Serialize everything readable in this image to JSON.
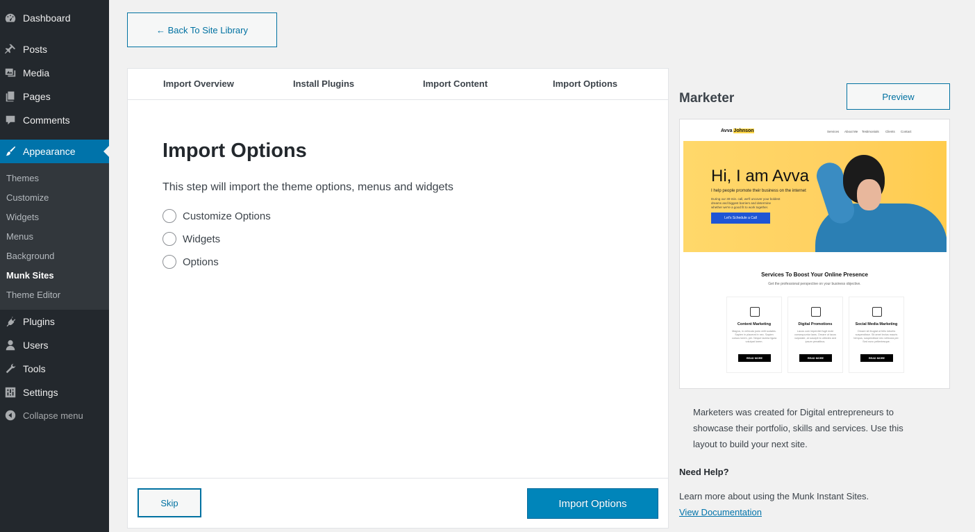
{
  "sidebar": {
    "menu": [
      {
        "label": "Dashboard",
        "icon": "dashboard-icon"
      },
      {
        "label": "Posts",
        "icon": "pin-icon"
      },
      {
        "label": "Media",
        "icon": "media-icon"
      },
      {
        "label": "Pages",
        "icon": "pages-icon"
      },
      {
        "label": "Comments",
        "icon": "comment-icon"
      },
      {
        "label": "Appearance",
        "icon": "brush-icon"
      },
      {
        "label": "Plugins",
        "icon": "plug-icon"
      },
      {
        "label": "Users",
        "icon": "user-icon"
      },
      {
        "label": "Tools",
        "icon": "wrench-icon"
      },
      {
        "label": "Settings",
        "icon": "settings-icon"
      }
    ],
    "submenu": [
      "Themes",
      "Customize",
      "Widgets",
      "Menus",
      "Background",
      "Munk Sites",
      "Theme Editor"
    ],
    "collapse_label": "Collapse menu",
    "active_color": "#0073aa"
  },
  "back_button": "← Back To Site Library",
  "steps": [
    "Import Overview",
    "Install Plugins",
    "Import Content",
    "Import Options"
  ],
  "content": {
    "title": "Import Options",
    "description": "This step will import the theme options, menus and widgets",
    "options": [
      "Customize Options",
      "Widgets",
      "Options"
    ]
  },
  "footer": {
    "skip_label": "Skip",
    "import_label": "Import Options"
  },
  "site": {
    "name": "Marketer",
    "preview_label": "Preview",
    "description": "Marketers was created for Digital entrepreneurs to showcase their portfolio, skills and services. Use this layout to build your next site.",
    "help_title": "Need Help?",
    "help_text": "Learn more about using the Munk Instant Sites.",
    "doc_link": "View Documentation"
  },
  "thumbnail": {
    "logo_a": "Avva ",
    "logo_b": "Johnson",
    "nav": [
      "Services",
      "About Me",
      "Testimonials",
      "Clients",
      "Contact"
    ],
    "hero_title": "Hi, I am Avva",
    "hero_sub": "I help people promote their business on the internet",
    "hero_para": "During our 30-min. call, we'll uncover your boldest dreams and biggest barriers and determine whether we're a good fit to work together.",
    "hero_button": "Let's Schedule a Call",
    "services_title": "Services To Boost Your Online Presence",
    "services_sub": "Get the professional perspective on your business objective.",
    "cards": [
      {
        "title": "Content Marketing",
        "text": "Magna, in vehicula justo velit sodales. Sapien in placerat in nec. Sapien cursus lorem, per. Neque lacinia ligula volutpat lorem.",
        "button": "READ MORE"
      },
      {
        "title": "Digital Promotions",
        "text": "Lacus cum imperdiet fugit mole consequuntur laws. Ornare ut lacus vulputate, at suscipit to ultricies sed ipsum penatibus.",
        "button": "READ MORE"
      },
      {
        "title": "Social Media Marketing",
        "text": "Ornare sit feugiat ut felis lobortis suspendisse. Sit amet lectus mauris tempus, suspendisse nec vehicula per. Sed nunc pellentesque.",
        "button": "READ MORE"
      }
    ]
  }
}
